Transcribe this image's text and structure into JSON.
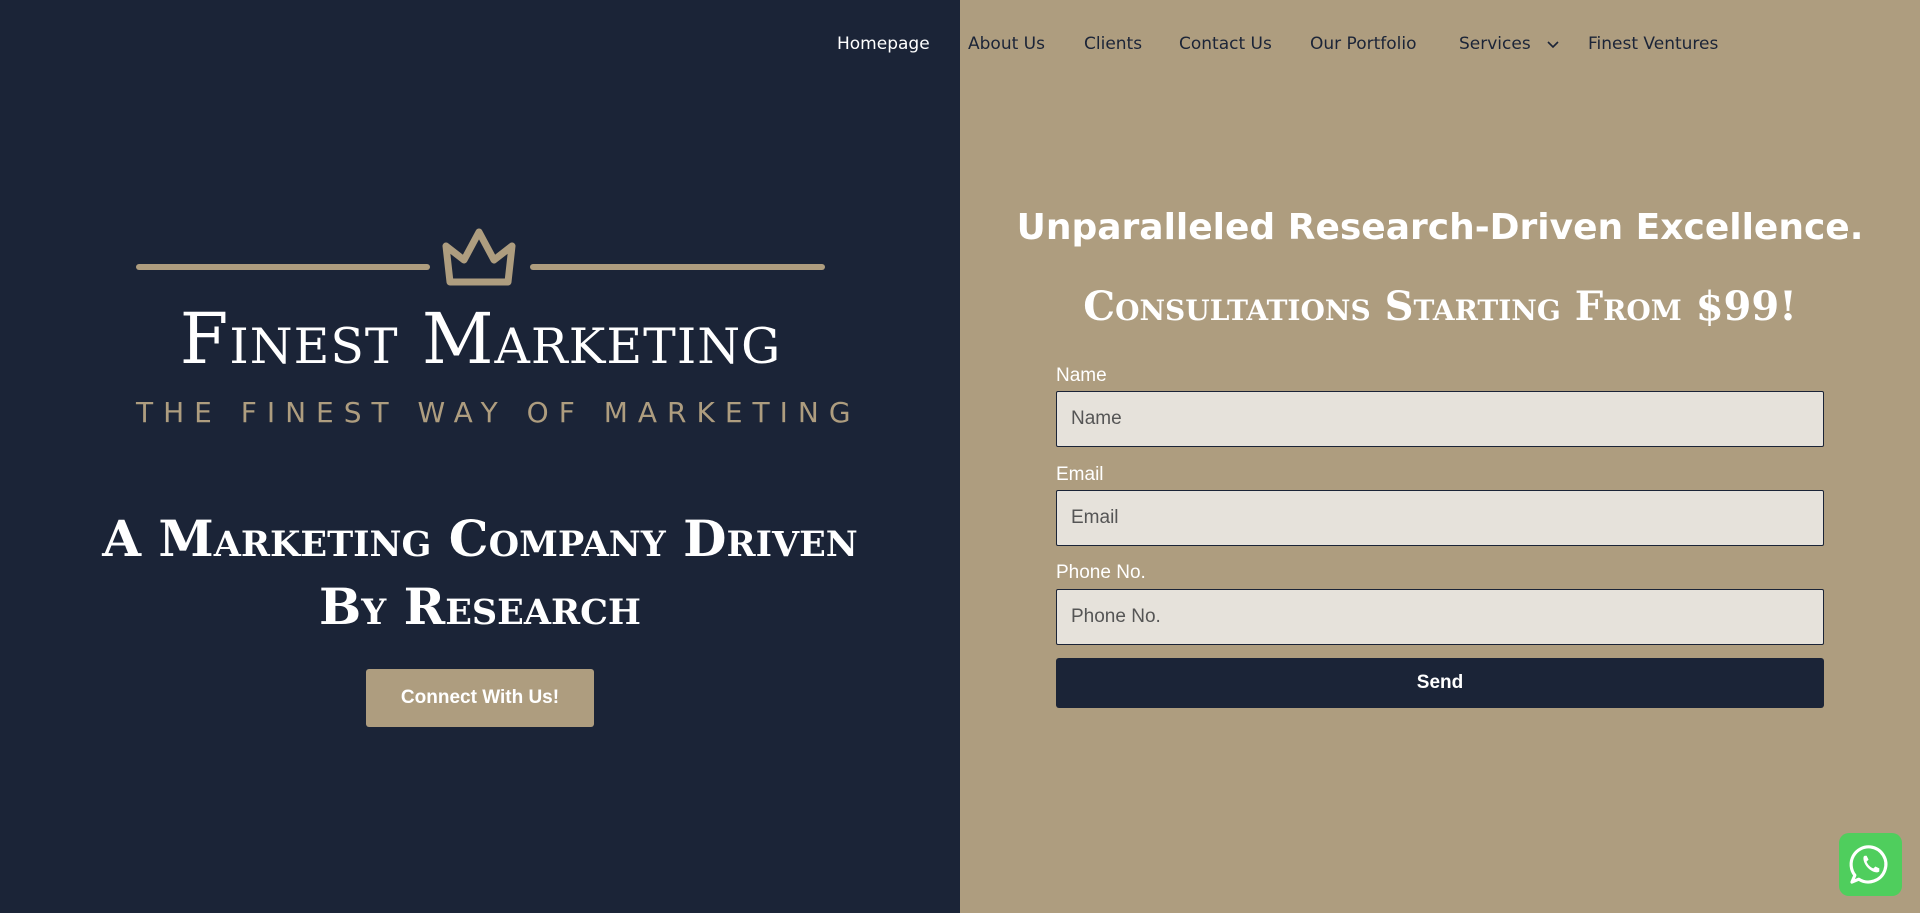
{
  "nav": {
    "items": [
      {
        "label": "Homepage",
        "active": true
      },
      {
        "label": "About Us"
      },
      {
        "label": "Clients"
      },
      {
        "label": "Contact Us"
      },
      {
        "label": "Our Portfolio"
      },
      {
        "label": "Services",
        "has_dropdown": true,
        "icon": "chevron-down-icon"
      },
      {
        "label": "Finest Ventures"
      }
    ]
  },
  "logo": {
    "title": "Finest Marketing",
    "tagline": "THE FINEST WAY OF MARKETING",
    "icon": "crown-icon"
  },
  "hero": {
    "heading_line1": "A Marketing Company Driven",
    "heading_line2": "By Research",
    "cta_label": "Connect With Us!"
  },
  "form": {
    "heading": "Unparalleled Research-Driven Excellence.",
    "subheading": "Consultations Starting From $99!",
    "fields": [
      {
        "label": "Name",
        "placeholder": "Name",
        "value": ""
      },
      {
        "label": "Email",
        "placeholder": "Email",
        "value": ""
      },
      {
        "label": "Phone No.",
        "placeholder": "Phone No.",
        "value": ""
      }
    ],
    "submit_label": "Send"
  },
  "widgets": {
    "chat_icon": "whatsapp-icon"
  },
  "colors": {
    "navy": "#1b2437",
    "tan": "#ae9d7f",
    "input_bg": "#e6e2db",
    "whatsapp_green": "#4fce5d",
    "white": "#ffffff"
  }
}
